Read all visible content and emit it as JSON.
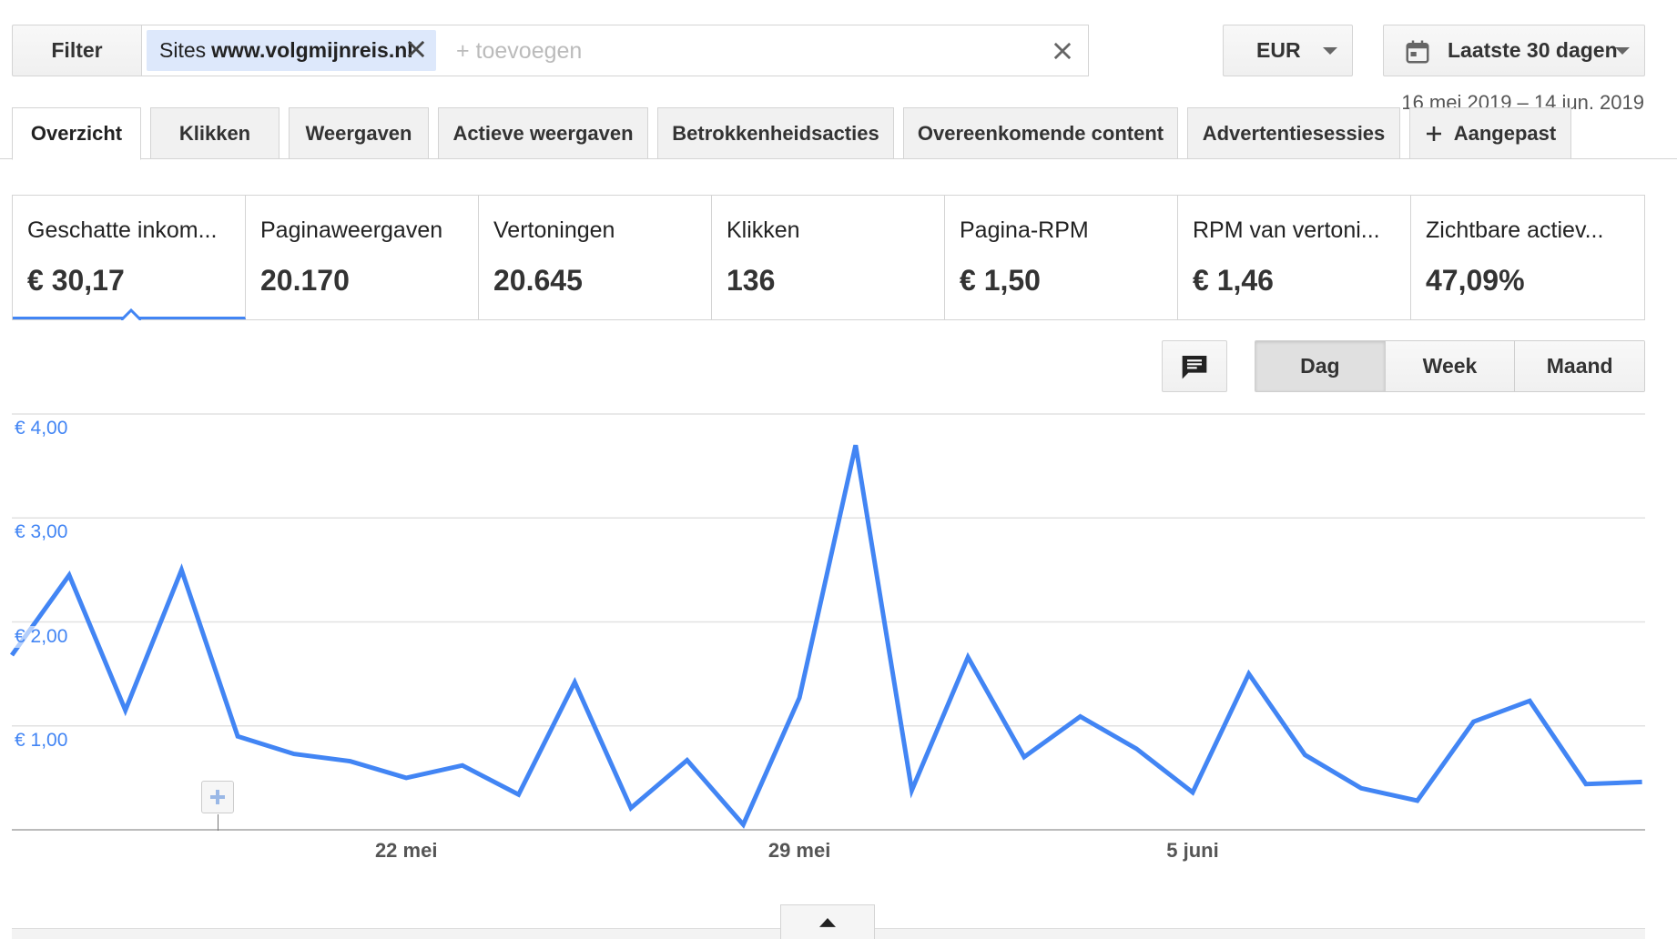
{
  "filter": {
    "button_label": "Filter",
    "chip_label": "Sites",
    "chip_value": "www.volgmijnreis.nl",
    "placeholder": "+ toevoegen"
  },
  "currency": {
    "label": "EUR"
  },
  "date": {
    "label": "Laatste 30 dagen",
    "range": "16 mei 2019 – 14 jun. 2019"
  },
  "tabs": [
    {
      "label": "Overzicht",
      "active": true
    },
    {
      "label": "Klikken"
    },
    {
      "label": "Weergaven"
    },
    {
      "label": "Actieve weergaven"
    },
    {
      "label": "Betrokkenheidsacties"
    },
    {
      "label": "Overeenkomende content"
    },
    {
      "label": "Advertentiesessies"
    },
    {
      "label": "Aangepast",
      "icon": "plus-icon"
    }
  ],
  "metrics": [
    {
      "label": "Geschatte inkom...",
      "value": "€ 30,17",
      "active": true
    },
    {
      "label": "Paginaweergaven",
      "value": "20.170"
    },
    {
      "label": "Vertoningen",
      "value": "20.645"
    },
    {
      "label": "Klikken",
      "value": "136"
    },
    {
      "label": "Pagina-RPM",
      "value": "€ 1,50"
    },
    {
      "label": "RPM van vertoni...",
      "value": "€ 1,46"
    },
    {
      "label": "Zichtbare actiev...",
      "value": "47,09%"
    }
  ],
  "controls": {
    "comment_icon": "comment-icon",
    "periods": [
      "Dag",
      "Week",
      "Maand"
    ],
    "active_period": "Dag"
  },
  "chart_data": {
    "type": "line",
    "x": [
      "16 mei",
      "17 mei",
      "18 mei",
      "19 mei",
      "20 mei",
      "21 mei",
      "22 mei",
      "23 mei",
      "24 mei",
      "25 mei",
      "26 mei",
      "27 mei",
      "28 mei",
      "29 mei",
      "30 mei",
      "31 mei",
      "1 juni",
      "2 juni",
      "3 juni",
      "4 juni",
      "5 juni",
      "6 juni",
      "7 juni",
      "8 juni",
      "9 juni",
      "10 juni",
      "11 juni",
      "12 juni",
      "13 juni",
      "14 juni"
    ],
    "series": [
      {
        "values": [
          2.45,
          1.15,
          2.5,
          0.9,
          0.73,
          0.66,
          0.5,
          0.62,
          0.34,
          1.42,
          0.21,
          0.67,
          0.05,
          1.27,
          3.7,
          0.38,
          1.66,
          0.7,
          1.09,
          0.78,
          0.36,
          1.5,
          0.72,
          0.4,
          0.28,
          1.04,
          1.24,
          0.44,
          0.46
        ]
      }
    ],
    "start_value": 1.68,
    "y_ticks": [
      "€ 1,00",
      "€ 2,00",
      "€ 3,00",
      "€ 4,00"
    ],
    "ylim": [
      0,
      4
    ],
    "x_ticks": [
      "22 mei",
      "29 mei",
      "5 juni"
    ],
    "color": "#4285f4"
  }
}
